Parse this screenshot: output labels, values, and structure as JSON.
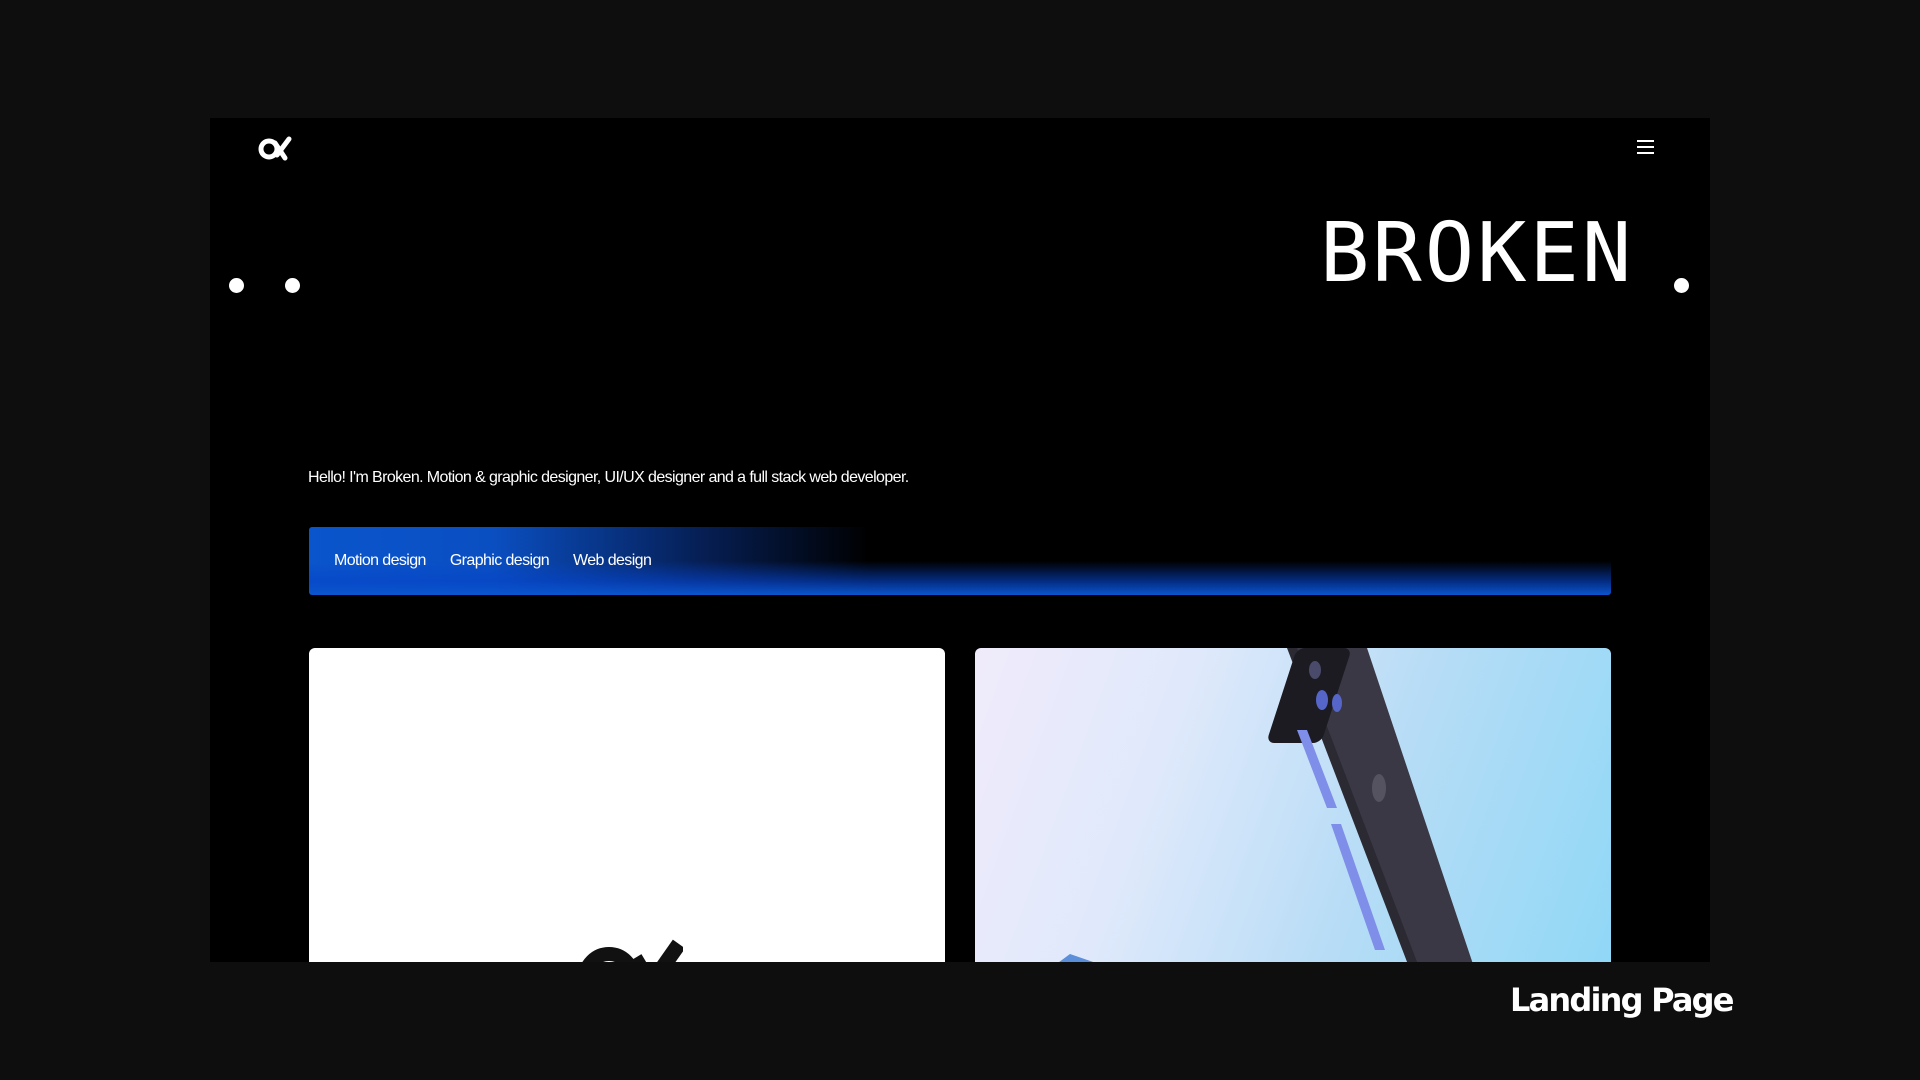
{
  "brand": {
    "logo_icon": "alpha-logo-icon",
    "title": "BROKEN"
  },
  "nav": {
    "menu_icon": "hamburger-menu-icon"
  },
  "hero": {
    "intro": "Hello! I'm Broken. Motion & graphic designer, UI/UX designer and a full stack web developer."
  },
  "tabs": [
    {
      "label": "Motion design"
    },
    {
      "label": "Graphic design"
    },
    {
      "label": "Web design"
    }
  ],
  "cards": [
    {
      "image": "alpha-logo-icon",
      "background": "#ffffff"
    },
    {
      "image": "phone-mockup",
      "background": "#b6dcf6"
    }
  ],
  "caption": "Landing Page",
  "colors": {
    "page_background": "#0e0e0e",
    "frame_background": "#000000",
    "accent_blue": "#0a55cc",
    "phone_body": "#35333f",
    "phone_buttons": "#7f8ee8"
  }
}
